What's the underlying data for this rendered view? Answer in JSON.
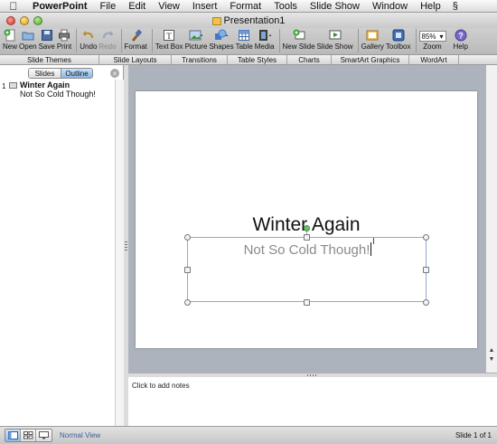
{
  "menubar": {
    "app": "PowerPoint",
    "items": [
      "File",
      "Edit",
      "View",
      "Insert",
      "Format",
      "Tools",
      "Slide Show",
      "Window",
      "Help"
    ]
  },
  "window": {
    "title": "Presentation1"
  },
  "toolbar": {
    "new": "New",
    "open": "Open",
    "save": "Save",
    "print": "Print",
    "undo": "Undo",
    "redo": "Redo",
    "format": "Format",
    "textbox": "Text Box",
    "picture": "Picture",
    "shapes": "Shapes",
    "table": "Table",
    "media": "Media",
    "newslide": "New Slide",
    "slideshow": "Slide Show",
    "gallery": "Gallery",
    "toolbox": "Toolbox",
    "zoom_value": "85%",
    "zoom": "Zoom",
    "help": "Help"
  },
  "ribbon": {
    "tabs": [
      "Slide Themes",
      "Slide Layouts",
      "Transitions",
      "Table Styles",
      "Charts",
      "SmartArt Graphics",
      "WordArt"
    ]
  },
  "leftpane": {
    "tab_slides": "Slides",
    "tab_outline": "Outline",
    "outline_number": "1",
    "outline_title": "Winter Again",
    "outline_subtitle": "Not So Cold Though!"
  },
  "slide": {
    "title": "Winter Again",
    "subtitle": "Not So Cold Though!"
  },
  "notes": {
    "placeholder": "Click to add notes"
  },
  "status": {
    "view": "Normal View",
    "slide_count": "Slide 1 of 1"
  },
  "colors": {
    "accent": "#86b7ea",
    "slide_bg": "#adb3bd",
    "rotate_handle": "#6cc46c"
  }
}
